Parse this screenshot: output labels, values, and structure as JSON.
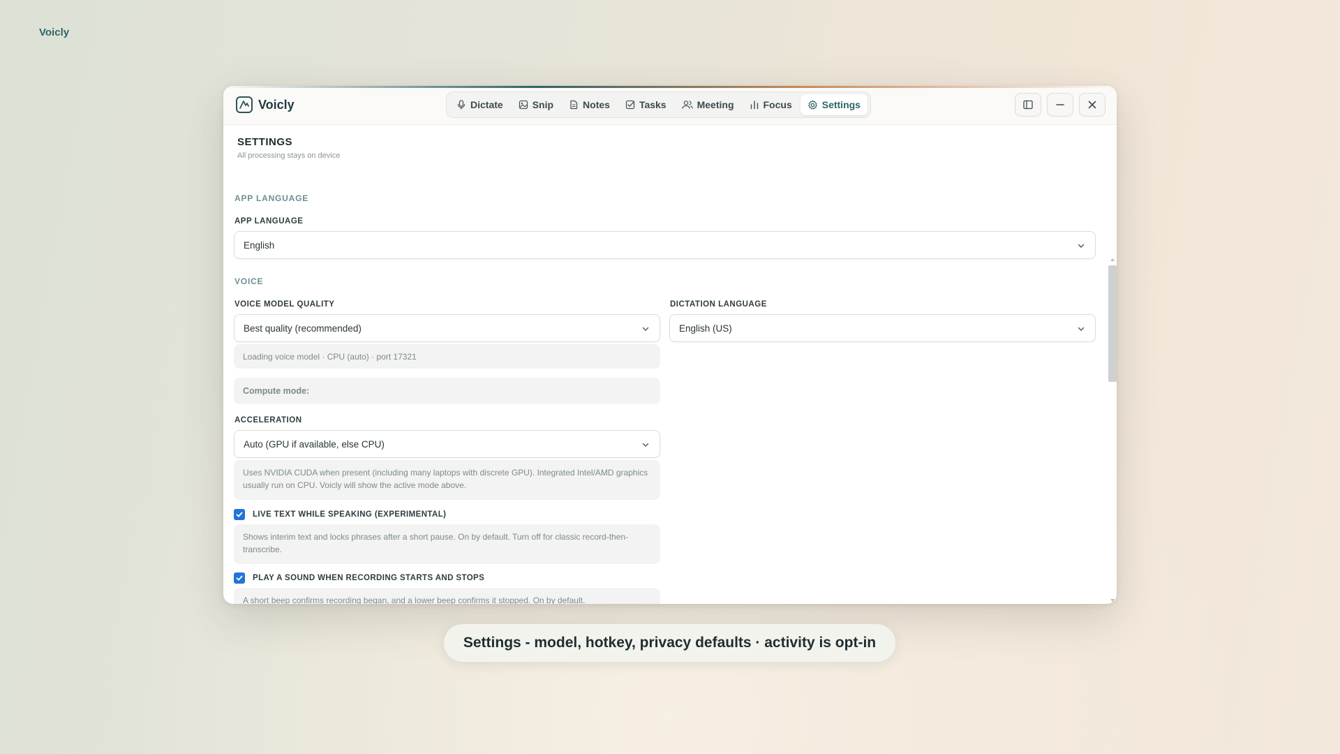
{
  "desktop": {
    "brand": "Voicly"
  },
  "app": {
    "name": "Voicly",
    "nav": [
      {
        "label": "Dictate",
        "icon": "microphone-icon"
      },
      {
        "label": "Snip",
        "icon": "image-icon"
      },
      {
        "label": "Notes",
        "icon": "document-icon"
      },
      {
        "label": "Tasks",
        "icon": "checkbox-icon"
      },
      {
        "label": "Meeting",
        "icon": "users-icon"
      },
      {
        "label": "Focus",
        "icon": "bar-chart-icon"
      },
      {
        "label": "Settings",
        "icon": "gear-icon",
        "active": true
      }
    ],
    "window_controls": [
      "sidebar-toggle-icon",
      "minimize-icon",
      "close-icon"
    ]
  },
  "settings": {
    "title": "SETTINGS",
    "subtitle": "All processing stays on device",
    "app_language_section": "APP LANGUAGE",
    "app_language_label": "APP LANGUAGE",
    "app_language_value": "English",
    "voice_section": "VOICE",
    "voice_model_label": "VOICE MODEL QUALITY",
    "voice_model_value": "Best quality (recommended)",
    "voice_model_status": "Loading voice model · CPU (auto) · port 17321",
    "dictation_language_label": "DICTATION LANGUAGE",
    "dictation_language_value": "English (US)",
    "compute_mode": "Compute mode:",
    "acceleration_label": "ACCELERATION",
    "acceleration_value": "Auto (GPU if available, else CPU)",
    "acceleration_hint": "Uses NVIDIA CUDA when present (including many laptops with discrete GPU). Integrated Intel/AMD graphics usually run on CPU. Voicly will show the active mode above.",
    "live_text_label": "LIVE TEXT WHILE SPEAKING (EXPERIMENTAL)",
    "live_text_checked": true,
    "live_text_hint": "Shows interim text and locks phrases after a short pause. On by default. Turn off for classic record-then-transcribe.",
    "sound_label": "PLAY A SOUND WHEN RECORDING STARTS AND STOPS",
    "sound_checked": true,
    "sound_hint": "A short beep confirms recording began, and a lower beep confirms it stopped. On by default."
  },
  "caption": "Settings - model, hotkey, privacy defaults · activity is opt-in",
  "colors": {
    "accent": "#2f6468",
    "checkbox": "#2474d8"
  }
}
